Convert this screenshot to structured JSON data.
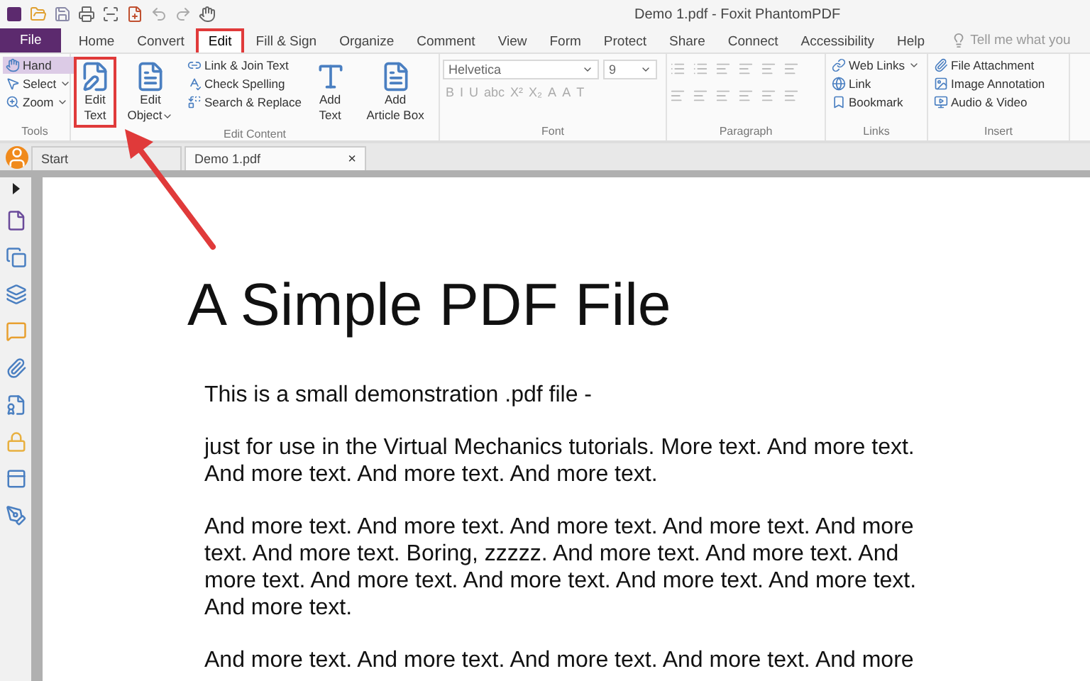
{
  "window": {
    "title": "Demo 1.pdf - Foxit PhantomPDF"
  },
  "file_menu": {
    "label": "File"
  },
  "menu_tabs": [
    {
      "label": "Home",
      "selected": false,
      "highlighted": false
    },
    {
      "label": "Convert",
      "selected": false,
      "highlighted": false
    },
    {
      "label": "Edit",
      "selected": true,
      "highlighted": true
    },
    {
      "label": "Fill & Sign",
      "selected": false,
      "highlighted": false
    },
    {
      "label": "Organize",
      "selected": false,
      "highlighted": false
    },
    {
      "label": "Comment",
      "selected": false,
      "highlighted": false
    },
    {
      "label": "View",
      "selected": false,
      "highlighted": false
    },
    {
      "label": "Form",
      "selected": false,
      "highlighted": false
    },
    {
      "label": "Protect",
      "selected": false,
      "highlighted": false
    },
    {
      "label": "Share",
      "selected": false,
      "highlighted": false
    },
    {
      "label": "Connect",
      "selected": false,
      "highlighted": false
    },
    {
      "label": "Accessibility",
      "selected": false,
      "highlighted": false
    },
    {
      "label": "Help",
      "selected": false,
      "highlighted": false
    }
  ],
  "tell_me": {
    "placeholder": "Tell me what you"
  },
  "ribbon": {
    "tools": {
      "label": "Tools",
      "items": [
        {
          "label": "Hand",
          "selected": true,
          "dropdown": false
        },
        {
          "label": "Select",
          "selected": false,
          "dropdown": true
        },
        {
          "label": "Zoom",
          "selected": false,
          "dropdown": true
        }
      ]
    },
    "edit_content": {
      "label": "Edit Content",
      "items": [
        {
          "kind": "large",
          "label": "Edit Text",
          "dropdown": false,
          "highlighted": true
        },
        {
          "kind": "large",
          "label": "Edit Object",
          "dropdown": true,
          "highlighted": false
        },
        {
          "kind": "stack",
          "entries": [
            {
              "label": "Link & Join Text"
            },
            {
              "label": "Check Spelling"
            },
            {
              "label": "Search & Replace"
            }
          ]
        },
        {
          "kind": "large",
          "label": "Add Text",
          "dropdown": false,
          "highlighted": false
        },
        {
          "kind": "large",
          "label": "Add Article Box",
          "dropdown": false,
          "highlighted": false
        }
      ]
    },
    "font": {
      "label": "Font",
      "family": "Helvetica",
      "size": "9",
      "format_buttons": [
        "B",
        "I",
        "U",
        "abc",
        "X²",
        "X₂",
        "A",
        "A",
        "T"
      ]
    },
    "paragraph": {
      "label": "Paragraph"
    },
    "links": {
      "label": "Links",
      "items": [
        {
          "label": "Web Links",
          "dropdown": true
        },
        {
          "label": "Link",
          "dropdown": false
        },
        {
          "label": "Bookmark",
          "dropdown": false
        }
      ]
    },
    "insert": {
      "label": "Insert",
      "items": [
        {
          "label": "File Attachment"
        },
        {
          "label": "Image Annotation"
        },
        {
          "label": "Audio & Video"
        }
      ]
    }
  },
  "doc_tabs": [
    {
      "label": "Start",
      "selected": false
    },
    {
      "label": "Demo 1.pdf",
      "selected": true,
      "close": "×"
    }
  ],
  "document": {
    "title": "A Simple PDF File",
    "paragraphs": [
      "This is a small demonstration .pdf file -",
      "just for use in the Virtual Mechanics tutorials. More text. And more text. And more text. And more text. And more text.",
      "And more text. And more text. And more text. And more text. And more text. And more text. Boring, zzzzz. And more text. And more text. And more text. And more text. And more text. And more text. And more text. And more text.",
      "And more text. And more text. And more text. And more text. And more"
    ]
  }
}
